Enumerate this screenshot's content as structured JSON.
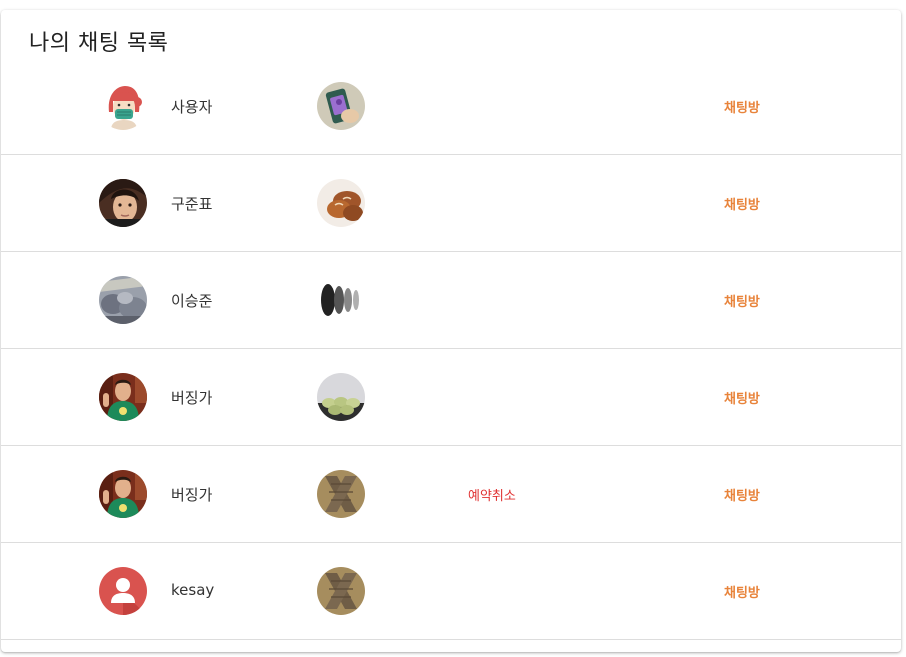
{
  "page": {
    "title": "나의 채팅 목록"
  },
  "chats": [
    {
      "user_name": "사용자",
      "avatar_icon": "masked-person-avatar-icon",
      "item_icon": "phone-case-photo-icon",
      "cancel_label": "",
      "chatroom_label": "채팅방"
    },
    {
      "user_name": "구준표",
      "avatar_icon": "person-photo-avatar-icon",
      "item_icon": "bread-photo-icon",
      "cancel_label": "",
      "chatroom_label": "채팅방"
    },
    {
      "user_name": "이승준",
      "avatar_icon": "blurred-photo-avatar-icon",
      "item_icon": "blurred-dark-object-photo-icon",
      "cancel_label": "",
      "chatroom_label": "채팅방"
    },
    {
      "user_name": "버징가",
      "avatar_icon": "person-green-shirt-avatar-icon",
      "item_icon": "macarons-photo-icon",
      "cancel_label": "",
      "chatroom_label": "채팅방"
    },
    {
      "user_name": "버징가",
      "avatar_icon": "person-green-shirt-avatar-icon",
      "item_icon": "scarf-photo-icon",
      "cancel_label": "예약취소",
      "chatroom_label": "채팅방"
    },
    {
      "user_name": "kesay",
      "avatar_icon": "default-user-avatar-icon",
      "item_icon": "scarf-photo-icon",
      "cancel_label": "",
      "chatroom_label": "채팅방"
    }
  ],
  "colors": {
    "chatroom_link": "#e8833a",
    "cancel_link": "#e03131",
    "default_avatar": "#d9534f"
  }
}
